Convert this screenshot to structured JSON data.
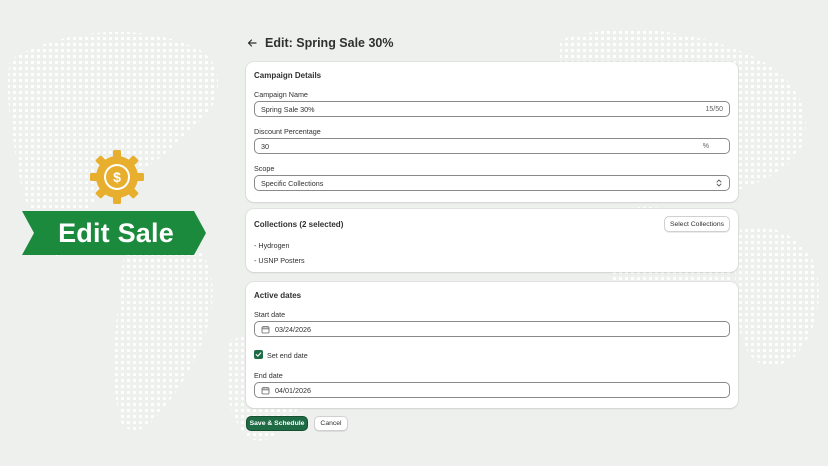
{
  "badge": {
    "label": "Edit Sale",
    "coin_symbol": "$"
  },
  "header": {
    "title": "Edit: Spring Sale 30%"
  },
  "campaign": {
    "title": "Campaign Details",
    "name_label": "Campaign Name",
    "name_value": "Spring Sale 30%",
    "name_counter": "15/50",
    "discount_label": "Discount Percentage",
    "discount_value": "30",
    "discount_suffix": "%",
    "scope_label": "Scope",
    "scope_value": "Specific Collections"
  },
  "collections": {
    "title": "Collections (2 selected)",
    "select_button": "Select Collections",
    "items": [
      "- Hydrogen",
      "- USNP Posters"
    ]
  },
  "dates": {
    "title": "Active dates",
    "start_label": "Start date",
    "start_value": "03/24/2026",
    "set_end_label": "Set end date",
    "set_end_checked": true,
    "end_label": "End date",
    "end_value": "04/01/2026"
  },
  "actions": {
    "save": "Save & Schedule",
    "cancel": "Cancel"
  },
  "colors": {
    "brand_green": "#1f6b45",
    "ribbon_green": "#1c8a3c",
    "gear_gold": "#e8ae2e"
  },
  "icons": [
    "back-arrow-icon",
    "gear-icon",
    "dollar-coin-icon",
    "calendar-icon",
    "select-arrows-icon",
    "checkmark-icon"
  ]
}
